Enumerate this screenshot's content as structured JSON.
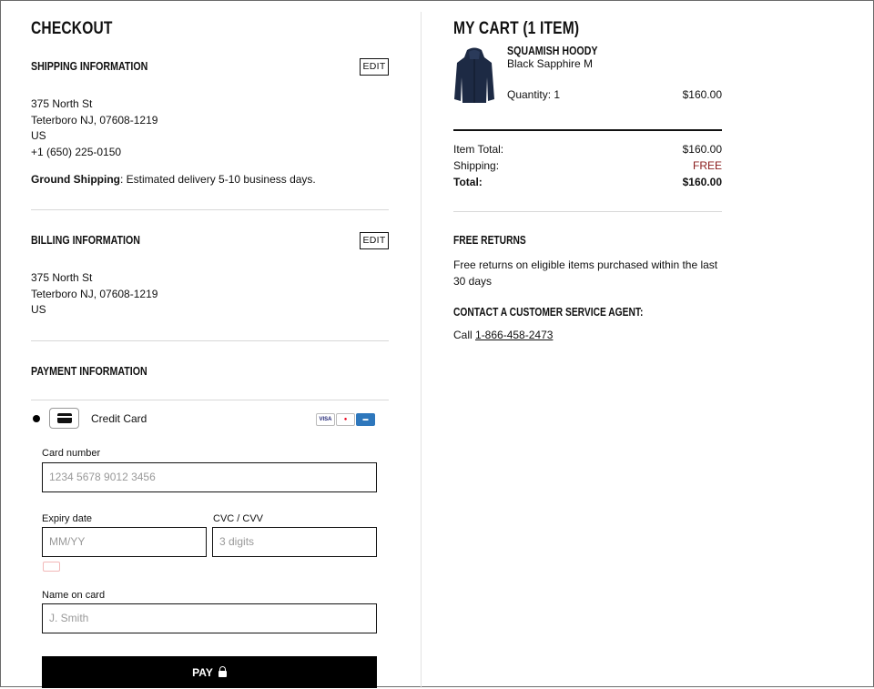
{
  "checkout": {
    "title": "CHECKOUT",
    "shipping": {
      "title": "SHIPPING INFORMATION",
      "edit": "EDIT",
      "address": [
        "375 North St",
        "Teterboro NJ, 07608-1219",
        "US",
        "+1 (650) 225-0150"
      ],
      "method_label": "Ground Shipping",
      "method_text": ": Estimated delivery 5-10 business days."
    },
    "billing": {
      "title": "BILLING INFORMATION",
      "edit": "EDIT",
      "address": [
        "375 North St",
        "Teterboro NJ, 07608-1219",
        "US"
      ]
    },
    "payment": {
      "title": "PAYMENT INFORMATION",
      "method": "Credit Card",
      "brands": [
        "VISA",
        "MC",
        "AMEX"
      ],
      "card_number": {
        "label": "Card number",
        "placeholder": "1234 5678 9012 3456"
      },
      "expiry": {
        "label": "Expiry date",
        "placeholder": "MM/YY"
      },
      "cvc": {
        "label": "CVC / CVV",
        "placeholder": "3 digits"
      },
      "name": {
        "label": "Name on card",
        "placeholder": "J. Smith"
      },
      "pay": "PAY"
    }
  },
  "cart": {
    "title": "MY CART (1 ITEM)",
    "item": {
      "name": "SQUAMISH HOODY",
      "variant": "Black Sapphire M",
      "quantity": "Quantity: 1",
      "price": "$160.00"
    },
    "summary": {
      "item_total_label": "Item Total:",
      "item_total": "$160.00",
      "shipping_label": "Shipping:",
      "shipping": "FREE",
      "total_label": "Total:",
      "total": "$160.00"
    },
    "returns": {
      "title": "FREE RETURNS",
      "text": "Free returns on eligible items purchased within the last 30 days"
    },
    "contact": {
      "title": "CONTACT A CUSTOMER SERVICE AGENT:",
      "call": "Call ",
      "phone": "1-866-458-2473"
    }
  },
  "colors": {
    "free": "#8a1c1c",
    "pay_bg": "#000000"
  }
}
